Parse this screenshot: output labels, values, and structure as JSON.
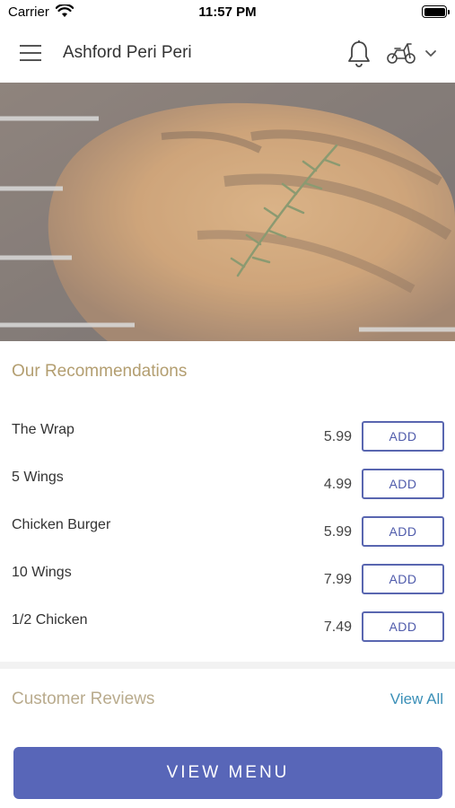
{
  "status_bar": {
    "carrier": "Carrier",
    "time": "11:57 PM"
  },
  "header": {
    "title": "Ashford Peri Peri",
    "icons": [
      "menu-icon",
      "bell-icon",
      "scooter-icon",
      "chevron-down-icon"
    ]
  },
  "hero": {
    "image": "grilled-chicken-with-rosemary"
  },
  "recommendations": {
    "title": "Our Recommendations",
    "items": [
      {
        "name": "The Wrap",
        "price": "5.99",
        "add_label": "ADD"
      },
      {
        "name": "5 Wings",
        "price": "4.99",
        "add_label": "ADD"
      },
      {
        "name": "Chicken Burger",
        "price": "5.99",
        "add_label": "ADD"
      },
      {
        "name": "10 Wings",
        "price": "7.99",
        "add_label": "ADD"
      },
      {
        "name": "1/2 Chicken",
        "price": "7.49",
        "add_label": "ADD"
      }
    ]
  },
  "reviews": {
    "title": "Customer Reviews",
    "view_all": "View All"
  },
  "footer": {
    "view_menu": "VIEW MENU"
  },
  "colors": {
    "accent": "#5866b8",
    "section_title": "#b39e70",
    "link": "#3a8fb7"
  }
}
